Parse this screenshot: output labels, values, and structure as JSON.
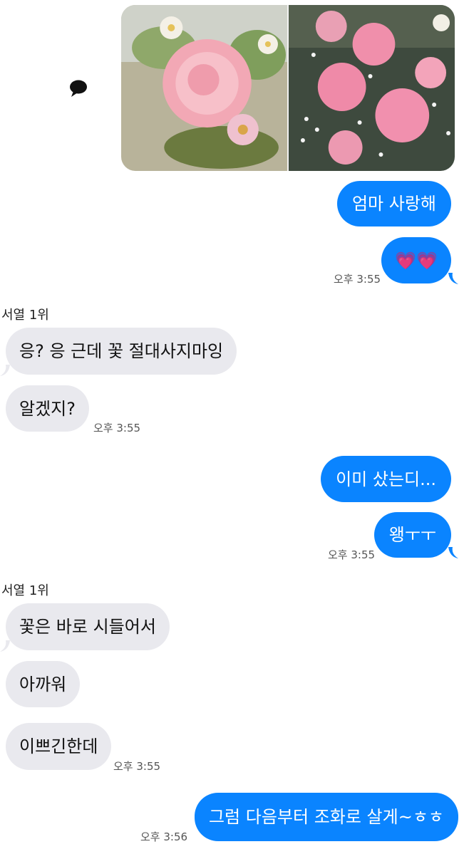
{
  "header": {
    "icon": "speech-bubble-icon"
  },
  "colors": {
    "outgoing_bubble": "#0a84ff",
    "incoming_bubble": "#e9e9ee",
    "outgoing_text": "#ffffff",
    "incoming_text": "#111111"
  },
  "photos": {
    "items": [
      {
        "icon": "flower-photo-left"
      },
      {
        "icon": "flower-photo-right"
      }
    ]
  },
  "messages": {
    "m1": {
      "text": "엄마 사랑해"
    },
    "m2": {
      "text": "💗💗",
      "timestamp": "오후 3:55"
    },
    "group2_sender": "서열 1위",
    "m3": {
      "text": "응? 응 근데 꽃 절대사지마잉"
    },
    "m4": {
      "text": "알겠지?",
      "timestamp": "오후 3:55"
    },
    "m5": {
      "text": "이미 샀는디..."
    },
    "m6": {
      "text": "왱ㅜㅜ",
      "timestamp": "오후 3:55"
    },
    "group4_sender": "서열 1위",
    "m7": {
      "text": "꽃은 바로 시들어서"
    },
    "m8": {
      "text": "아까워"
    },
    "m9": {
      "text": "이쁘긴한데",
      "timestamp": "오후 3:55"
    },
    "m10": {
      "text": "그럼 다음부터 조화로 살게~ㅎㅎ",
      "timestamp": "오후 3:56"
    }
  }
}
